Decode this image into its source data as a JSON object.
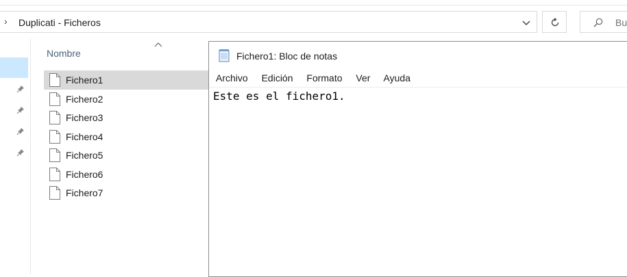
{
  "explorer": {
    "address_path": "Duplicati - Ficheros",
    "search_placeholder": "Bu",
    "column_header": "Nombre",
    "files": [
      {
        "name": "Fichero1",
        "selected": true
      },
      {
        "name": "Fichero2",
        "selected": false
      },
      {
        "name": "Fichero3",
        "selected": false
      },
      {
        "name": "Fichero4",
        "selected": false
      },
      {
        "name": "Fichero5",
        "selected": false
      },
      {
        "name": "Fichero6",
        "selected": false
      },
      {
        "name": "Fichero7",
        "selected": false
      }
    ]
  },
  "notepad": {
    "title": "Fichero1: Bloc de notas",
    "menu": [
      "Archivo",
      "Edición",
      "Formato",
      "Ver",
      "Ayuda"
    ],
    "content": "Este es el fichero1."
  },
  "colors": {
    "selection": "#d9d9d9",
    "nav_selection": "#cce8ff",
    "header_text": "#4c607a"
  },
  "icons": [
    "chevron-right-icon",
    "chevron-down-icon",
    "refresh-icon",
    "search-icon",
    "pin-icon",
    "document-icon",
    "notepad-icon",
    "sort-up-icon"
  ]
}
